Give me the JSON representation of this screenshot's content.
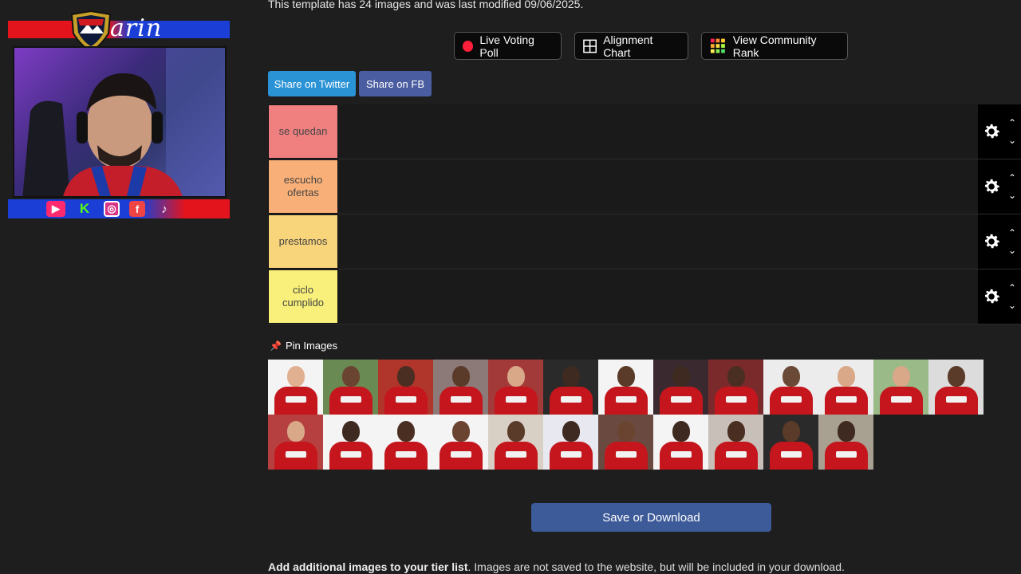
{
  "overlay": {
    "name": "arin",
    "social_icons": [
      "youtube-icon",
      "kick-icon",
      "instagram-icon",
      "facebook-icon",
      "tiktok-icon"
    ]
  },
  "info": {
    "line": "This template has 24 images and was last modified 09/06/2025."
  },
  "toolbar": {
    "live_poll": "Live Voting Poll",
    "alignment": "Alignment Chart",
    "community": "View Community Rank"
  },
  "share": {
    "twitter": "Share on Twitter",
    "fb": "Share on FB",
    "twitter_color": "#2a93d6",
    "fb_color": "#4a5da0"
  },
  "tiers": [
    {
      "label": "se quedan",
      "color": "#f08080"
    },
    {
      "label": "escucho ofertas",
      "color": "#f8b078"
    },
    {
      "label": "prestamos",
      "color": "#f8d47a"
    },
    {
      "label": "ciclo cumplido",
      "color": "#f8f07a"
    }
  ],
  "pool": {
    "title": "Pin Images",
    "count": 24
  },
  "save": {
    "label": "Save or Download"
  },
  "footer": {
    "bold": "Add additional images to your tier list",
    "rest": ". Images are not saved to the website, but will be included in your download."
  }
}
